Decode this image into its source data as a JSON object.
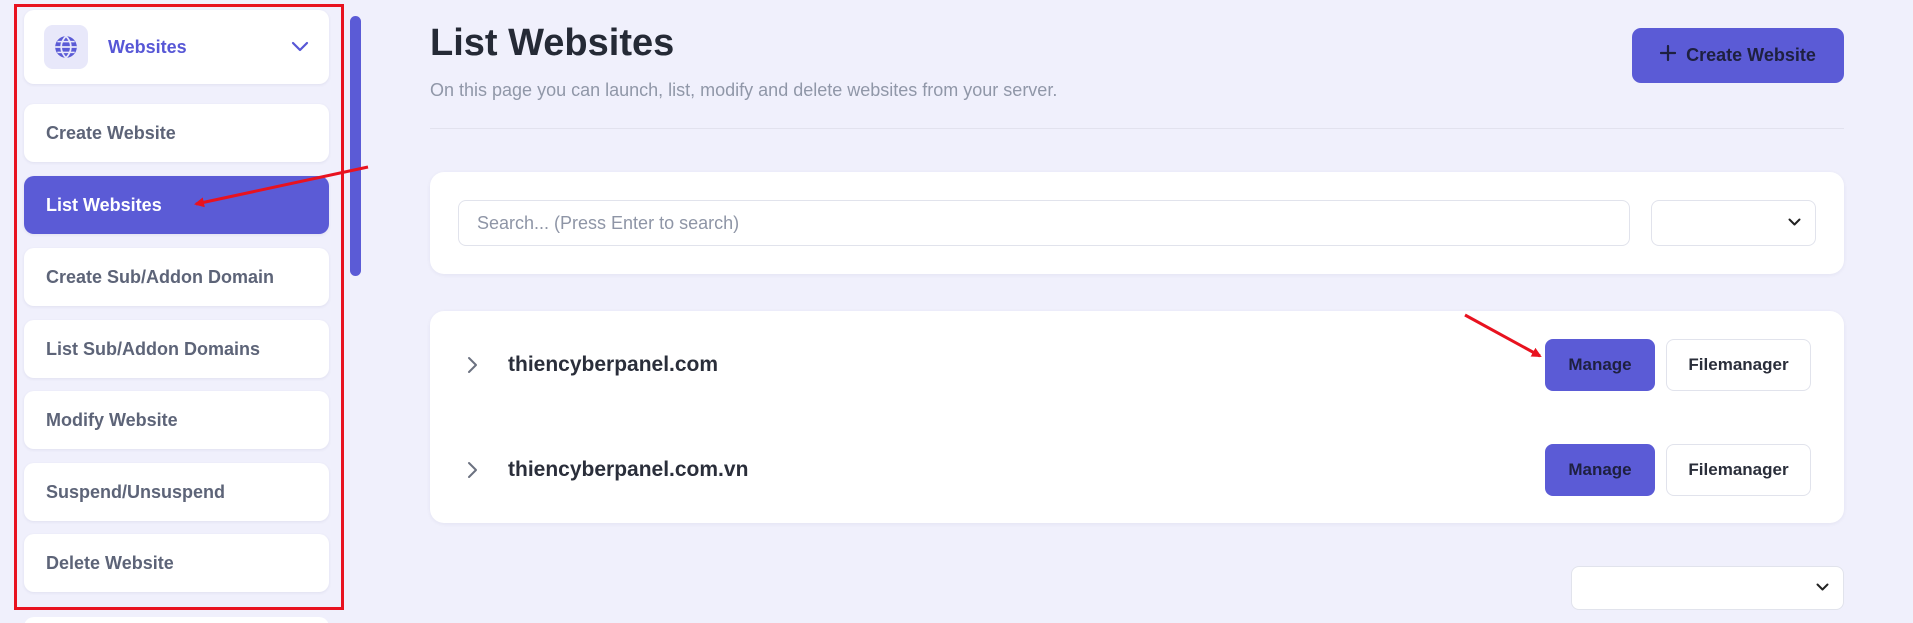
{
  "sidebar": {
    "header": {
      "label": "Websites",
      "icon": "globe-icon",
      "chevron": "chevron-down-icon"
    },
    "items": [
      {
        "label": "Create Website",
        "active": false
      },
      {
        "label": "List Websites",
        "active": true
      },
      {
        "label": "Create Sub/Addon Domain",
        "active": false
      },
      {
        "label": "List Sub/Addon Domains",
        "active": false
      },
      {
        "label": "Modify Website",
        "active": false
      },
      {
        "label": "Suspend/Unsuspend",
        "active": false
      },
      {
        "label": "Delete Website",
        "active": false
      }
    ]
  },
  "main": {
    "title": "List Websites",
    "subtitle": "On this page you can launch, list, modify and delete websites from your server.",
    "create_button": {
      "label": "Create Website",
      "icon": "plus-icon"
    },
    "search": {
      "placeholder": "Search... (Press Enter to search)",
      "value": ""
    },
    "filter_select": {
      "selected": ""
    },
    "websites": [
      {
        "domain": "thiencyberpanel.com",
        "manage_label": "Manage",
        "filemanager_label": "Filemanager"
      },
      {
        "domain": "thiencyberpanel.com.vn",
        "manage_label": "Manage",
        "filemanager_label": "Filemanager"
      }
    ],
    "page_select": {
      "selected": ""
    }
  },
  "colors": {
    "accent": "#5b5bd6",
    "background": "#f0f0fc",
    "annotation_red": "#e8121f"
  }
}
